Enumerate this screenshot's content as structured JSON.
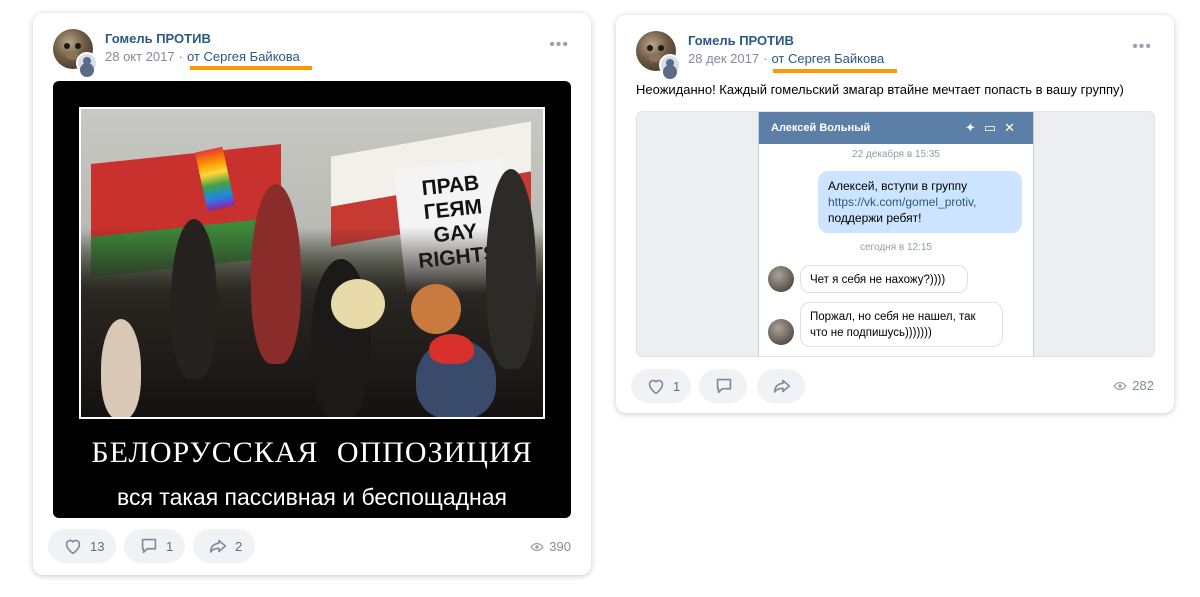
{
  "post1": {
    "author": "Гомель ПРОТИВ",
    "date": "28 окт 2017",
    "separator": "·",
    "from": "от Сергея Байкова",
    "more": "•••",
    "image": {
      "sign_text": "ПРАВ\nГЕЯМ\nGAY\nRIGHTS",
      "caption_line1": "БЕЛОРУССКАЯ ОППОЗИЦИЯ",
      "caption_line2": "вся такая пассивная и беспощадная"
    },
    "likes": "13",
    "comments": "1",
    "shares": "2",
    "views": "390"
  },
  "post2": {
    "author": "Гомель ПРОТИВ",
    "date": "28 дек 2017",
    "separator": "·",
    "from": "от Сергея Байкова",
    "more": "•••",
    "text": "Неожиданно! Каждый гомельский змагар втайне мечтает попасть в вашу группу)",
    "chat": {
      "title": "Алексей Вольный",
      "date1": "22 декабря в 15:35",
      "out_line1": "Алексей, вступи в группу",
      "out_link": "https://vk.com/gomel_protiv,",
      "out_line3": "поддержи ребят!",
      "date2": "сегодня в 12:15",
      "in1": "Чет я себя не нахожу?))))",
      "in2": "Поржал, но себя не нашел, так что не подпишусь)))))))"
    },
    "likes": "1",
    "views": "282"
  },
  "icons": [
    "heart-icon",
    "comment-icon",
    "share-icon",
    "eye-icon",
    "pin-icon",
    "minimize-icon",
    "close-icon"
  ],
  "colors": {
    "link": "#2a5885",
    "highlight": "#ff9800",
    "chat_header": "#5b7fa6",
    "bubble_out": "#cce4ff"
  }
}
